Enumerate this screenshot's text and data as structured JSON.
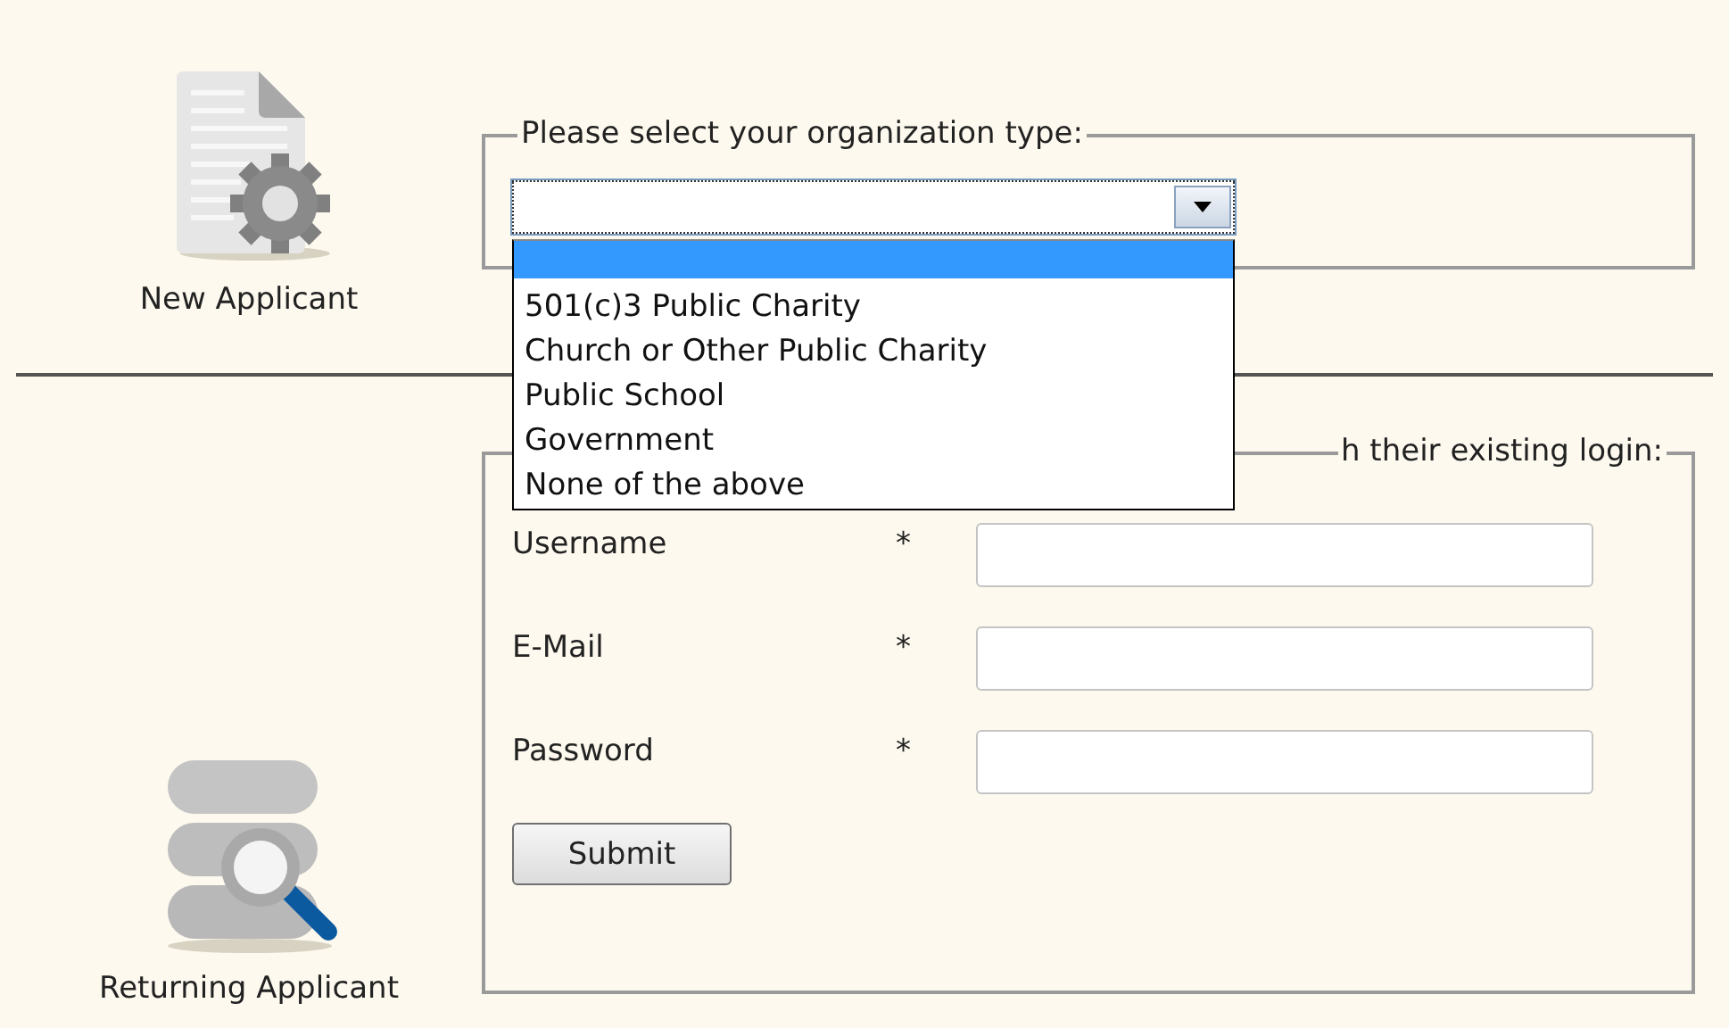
{
  "new_applicant": {
    "label": "New Applicant"
  },
  "organization": {
    "legend": "Please select your organization type:",
    "expanded": true,
    "options": [
      {
        "selected": true
      },
      {
        "label": "501(c)3 Public Charity",
        "selected": false
      },
      {
        "label": "Church or Other Public Charity",
        "selected": false
      },
      {
        "label": "Public School",
        "selected": false
      },
      {
        "label": "Government",
        "selected": false
      },
      {
        "label": "None of the above",
        "selected": false
      }
    ]
  },
  "returning_applicant": {
    "label": "Returning Applicant"
  },
  "login": {
    "legend_visible_part": "h their existing login:",
    "fields": [
      {
        "label": "Username",
        "required_mark": "*"
      },
      {
        "label": "E-Mail",
        "required_mark": "*"
      },
      {
        "label": "Password",
        "required_mark": "*"
      }
    ],
    "submit": "Submit"
  }
}
